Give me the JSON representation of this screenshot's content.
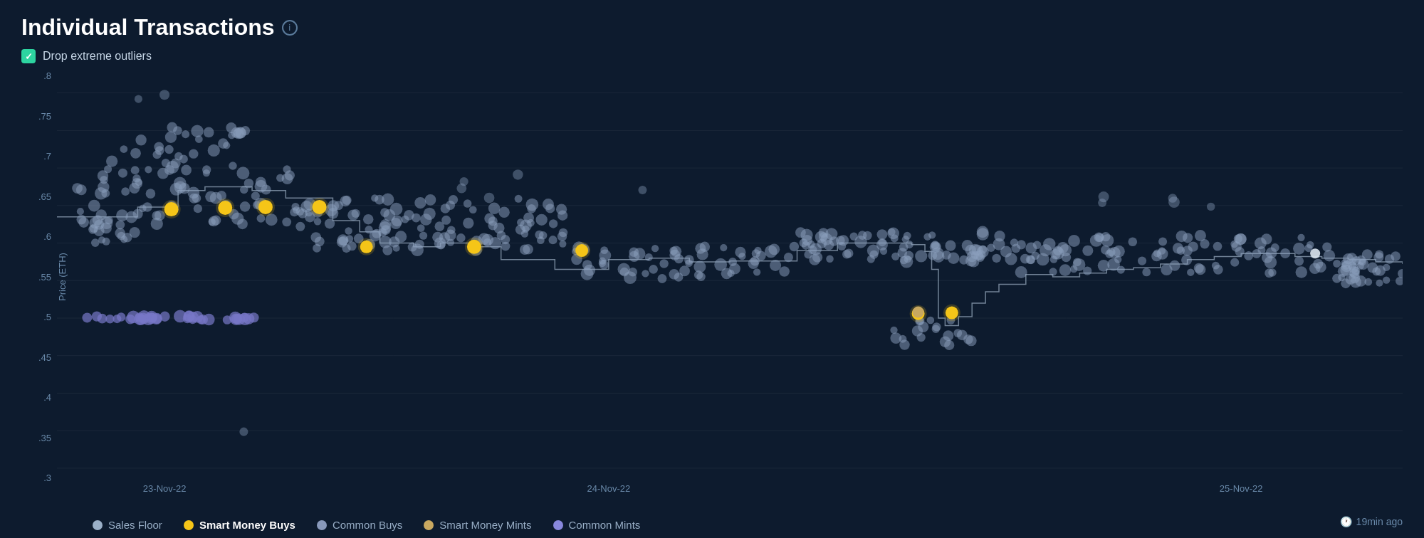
{
  "header": {
    "title": "Individual Transactions",
    "info_label": "i"
  },
  "checkbox": {
    "label": "Drop extreme outliers",
    "checked": true
  },
  "chart": {
    "y_axis": {
      "labels": [
        ".8",
        ".75",
        ".7",
        ".65",
        ".6",
        ".55",
        ".5",
        ".45",
        ".4",
        ".35",
        ".3"
      ],
      "axis_label": "Price (ETH)"
    },
    "x_axis": {
      "labels": [
        "23-Nov-22",
        "24-Nov-22",
        "25-Nov-22"
      ]
    }
  },
  "legend": {
    "items": [
      {
        "label": "Sales Floor",
        "color": "#9ab0c8",
        "bold": false
      },
      {
        "label": "Smart Money Buys",
        "color": "#f5c518",
        "bold": true
      },
      {
        "label": "Common Buys",
        "color": "#8899bb",
        "bold": false
      },
      {
        "label": "Smart Money Mints",
        "color": "#c8a860",
        "bold": false
      },
      {
        "label": "Common Mints",
        "color": "#8888dd",
        "bold": false
      }
    ]
  },
  "timestamp": {
    "text": "19min ago"
  }
}
